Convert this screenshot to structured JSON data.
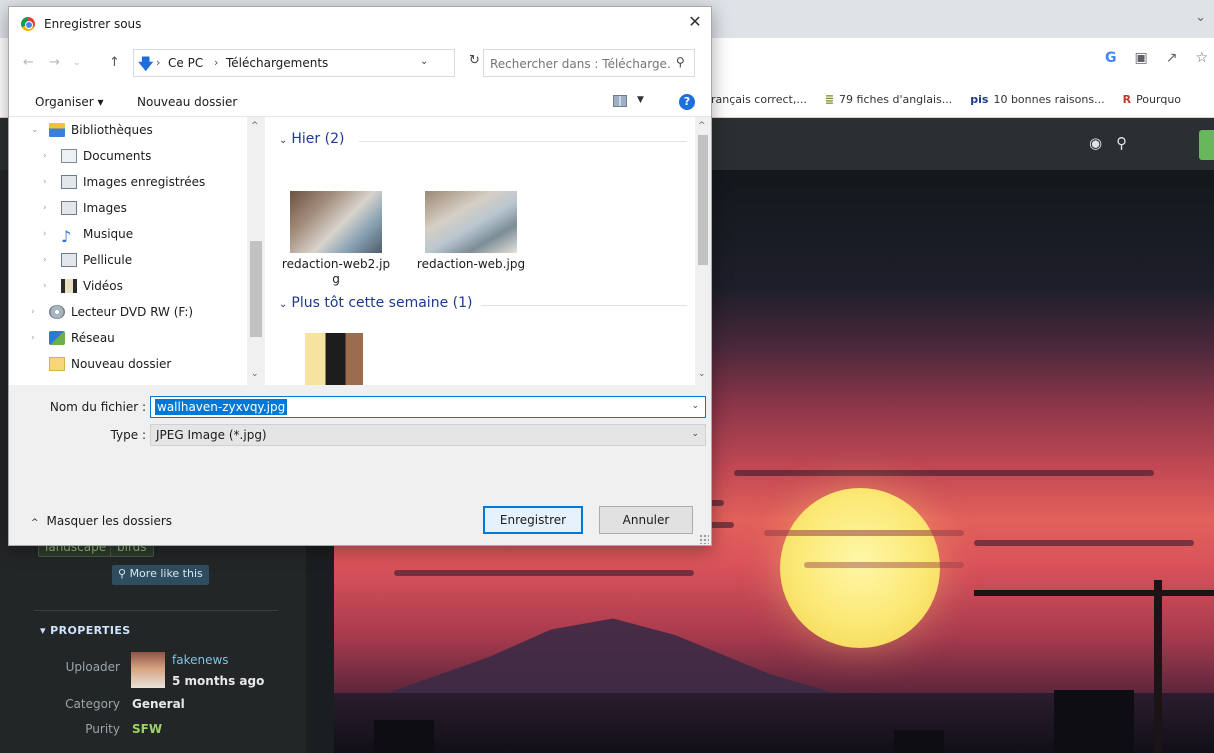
{
  "browser": {
    "bookmarks": [
      {
        "icon": "",
        "label": "rançais correct,..."
      },
      {
        "icon": "≣",
        "label": "79 fiches d'anglais..."
      },
      {
        "icon": "pis",
        "label": "10 bonnes raisons..."
      },
      {
        "icon": "R",
        "label": "Pourquo"
      }
    ],
    "toolbar_icons": [
      "G",
      "translate-icon",
      "share-icon",
      "star-icon"
    ]
  },
  "sidebar": {
    "tags": [
      "landscape",
      "birds"
    ],
    "more_like": "More like this",
    "properties_title": "PROPERTIES",
    "properties": [
      {
        "label": "Uploader",
        "value": "5 months ago",
        "link": "fakenews"
      },
      {
        "label": "Category",
        "value": "General"
      },
      {
        "label": "Purity",
        "value": "SFW"
      }
    ]
  },
  "dialog": {
    "title": "Enregistrer sous",
    "address": {
      "crumbs": [
        "Ce PC",
        "Téléchargements"
      ]
    },
    "search_placeholder": "Rechercher dans : Télécharge...",
    "commands": {
      "organize": "Organiser",
      "new_folder": "Nouveau dossier"
    },
    "tree": [
      {
        "label": "Bibliothèques",
        "icon": "library-icon",
        "indent": 0,
        "expanded": true
      },
      {
        "label": "Documents",
        "icon": "documents-icon",
        "indent": 1
      },
      {
        "label": "Images enregistrées",
        "icon": "saved-pictures-icon",
        "indent": 1
      },
      {
        "label": "Images",
        "icon": "pictures-icon",
        "indent": 1
      },
      {
        "label": "Musique",
        "icon": "music-icon",
        "indent": 1
      },
      {
        "label": "Pellicule",
        "icon": "camera-roll-icon",
        "indent": 1
      },
      {
        "label": "Vidéos",
        "icon": "videos-icon",
        "indent": 1
      },
      {
        "label": "Lecteur DVD RW (F:)",
        "icon": "dvd-drive-icon",
        "indent": 0
      },
      {
        "label": "Réseau",
        "icon": "network-icon",
        "indent": 0
      },
      {
        "label": "Nouveau dossier",
        "icon": "folder-icon",
        "indent": 0
      }
    ],
    "groups": [
      {
        "title": "Hier (2)",
        "files": [
          "redaction-web2.jpg",
          "redaction-web.jpg"
        ]
      },
      {
        "title": "Plus tôt cette semaine (1)",
        "files": [
          ""
        ]
      }
    ],
    "filename_label": "Nom du fichier :",
    "filename_value": "wallhaven-zyxvqy.jpg",
    "type_label": "Type :",
    "type_value": "JPEG Image (*.jpg)",
    "hide_folders": "Masquer les dossiers",
    "save_label": "Enregistrer",
    "cancel_label": "Annuler"
  },
  "colors": {
    "accent": "#0078d7",
    "sidebar_bg": "#232627",
    "tag_text": "#8fb97c",
    "link": "#7ec3e6"
  }
}
